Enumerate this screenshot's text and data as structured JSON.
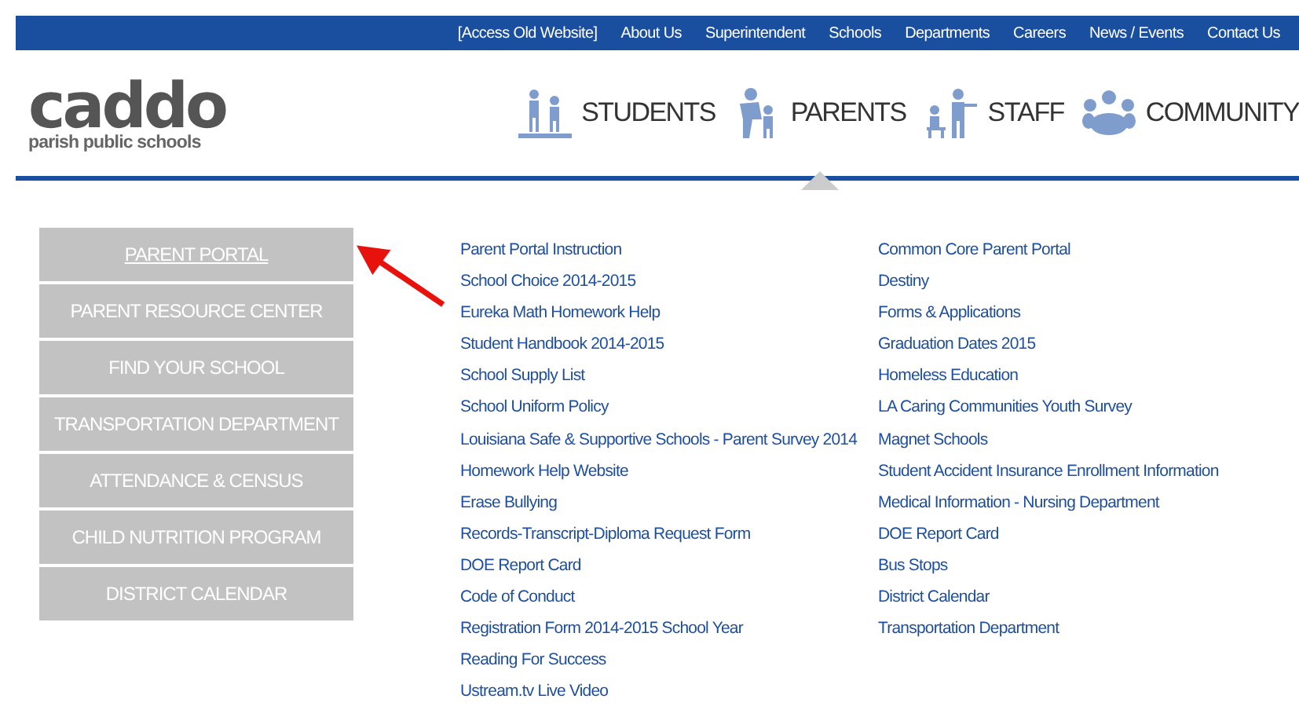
{
  "top_links": [
    "[Access Old Website]",
    "About Us",
    "Superintendent",
    "Schools",
    "Departments",
    "Careers",
    "News / Events",
    "Contact Us"
  ],
  "logo": {
    "name": "caddo",
    "subtitle": "parish public schools"
  },
  "main_nav": [
    {
      "label": "STUDENTS",
      "kind": "students",
      "selected": false
    },
    {
      "label": "PARENTS",
      "kind": "parents",
      "selected": true
    },
    {
      "label": "STAFF",
      "kind": "staff",
      "selected": false
    },
    {
      "label": "COMMUNITY",
      "kind": "community",
      "selected": false
    }
  ],
  "side_buttons": [
    {
      "label": "PARENT PORTAL",
      "selected": true
    },
    {
      "label": "PARENT RESOURCE CENTER",
      "selected": false
    },
    {
      "label": "FIND YOUR SCHOOL",
      "selected": false
    },
    {
      "label": "TRANSPORTATION DEPARTMENT",
      "selected": false
    },
    {
      "label": "ATTENDANCE & CENSUS",
      "selected": false
    },
    {
      "label": "CHILD NUTRITION PROGRAM",
      "selected": false
    },
    {
      "label": "DISTRICT CALENDAR",
      "selected": false
    }
  ],
  "links_column_1": [
    "Parent Portal Instruction",
    "School Choice 2014-2015",
    "Eureka Math Homework Help",
    "Student Handbook 2014-2015",
    "School Supply List",
    "School Uniform Policy",
    "Louisiana Safe & Supportive Schools - Parent Survey 2014",
    "Homework Help Website",
    "Erase Bullying",
    "Records-Transcript-Diploma Request Form",
    "DOE Report Card",
    "Code of Conduct",
    "Registration Form 2014-2015 School Year",
    "Reading For Success",
    "Ustream.tv Live Video"
  ],
  "links_column_2": [
    "Common Core Parent Portal",
    "Destiny",
    "Forms & Applications",
    "Graduation Dates 2015",
    "Homeless Education",
    "LA Caring Communities Youth Survey",
    "Magnet Schools",
    "Student Accident Insurance Enrollment Information",
    "Medical Information - Nursing Department",
    "DOE Report Card",
    "Bus Stops",
    "District Calendar",
    "Transportation Department"
  ]
}
